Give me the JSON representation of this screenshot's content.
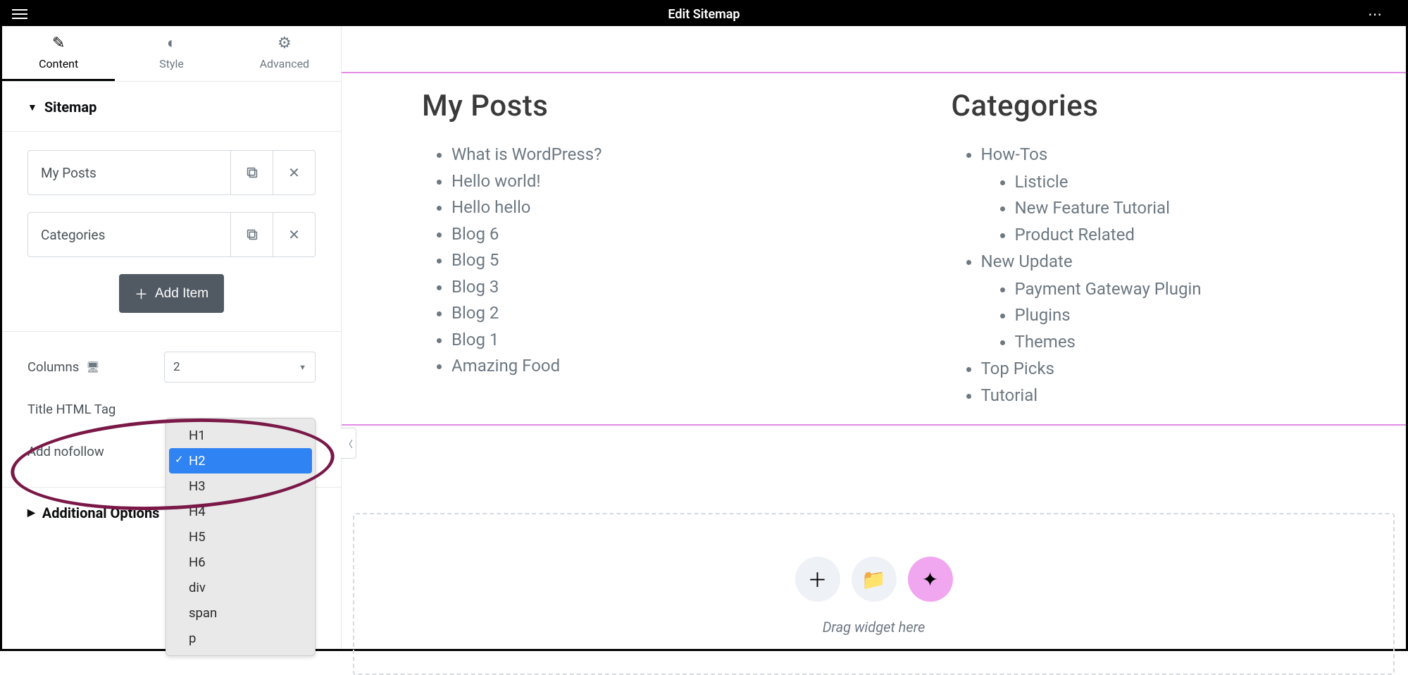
{
  "topbar": {
    "title": "Edit Sitemap"
  },
  "tabs": {
    "content": "Content",
    "style": "Style",
    "advanced": "Advanced"
  },
  "panel": {
    "sitemap_title": "Sitemap",
    "additional_title": "Additional Options"
  },
  "items": [
    {
      "label": "My Posts"
    },
    {
      "label": "Categories"
    }
  ],
  "add_item_label": "Add Item",
  "controls": {
    "columns_label": "Columns",
    "columns_value": "2",
    "title_tag_label": "Title HTML Tag",
    "title_tag_value": "H2",
    "title_tag_options": [
      "H1",
      "H2",
      "H3",
      "H4",
      "H5",
      "H6",
      "div",
      "span",
      "p"
    ],
    "nofollow_label": "Add nofollow"
  },
  "canvas": {
    "posts_title": "My Posts",
    "posts": [
      "What is WordPress?",
      "Hello world!",
      "Hello hello",
      "Blog 6",
      "Blog 5",
      "Blog 3",
      "Blog 2",
      "Blog 1",
      "Amazing Food"
    ],
    "categories_title": "Categories",
    "categories": [
      {
        "label": "How-Tos",
        "children": [
          "Listicle",
          "New Feature Tutorial",
          "Product Related"
        ]
      },
      {
        "label": "New Update",
        "children": [
          "Payment Gateway Plugin",
          "Plugins",
          "Themes"
        ]
      },
      {
        "label": "Top Picks",
        "children": []
      },
      {
        "label": "Tutorial",
        "children": []
      }
    ],
    "drop_text": "Drag widget here"
  }
}
